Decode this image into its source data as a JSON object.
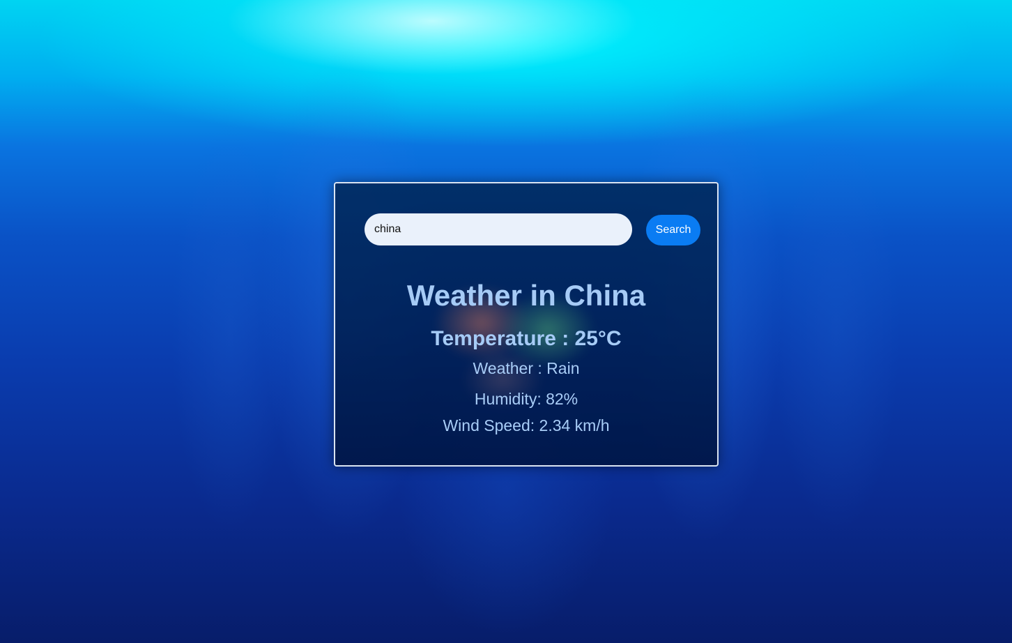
{
  "search": {
    "value": "china",
    "button_label": "Search"
  },
  "weather": {
    "title": "Weather in China",
    "temperature": "Temperature : 25°C",
    "condition": "Weather : Rain",
    "humidity": "Humidity: 82%",
    "wind_speed": "Wind Speed: 2.34 km/h"
  },
  "colors": {
    "accent": "#0a7cf3",
    "text": "#a6cbf6"
  }
}
